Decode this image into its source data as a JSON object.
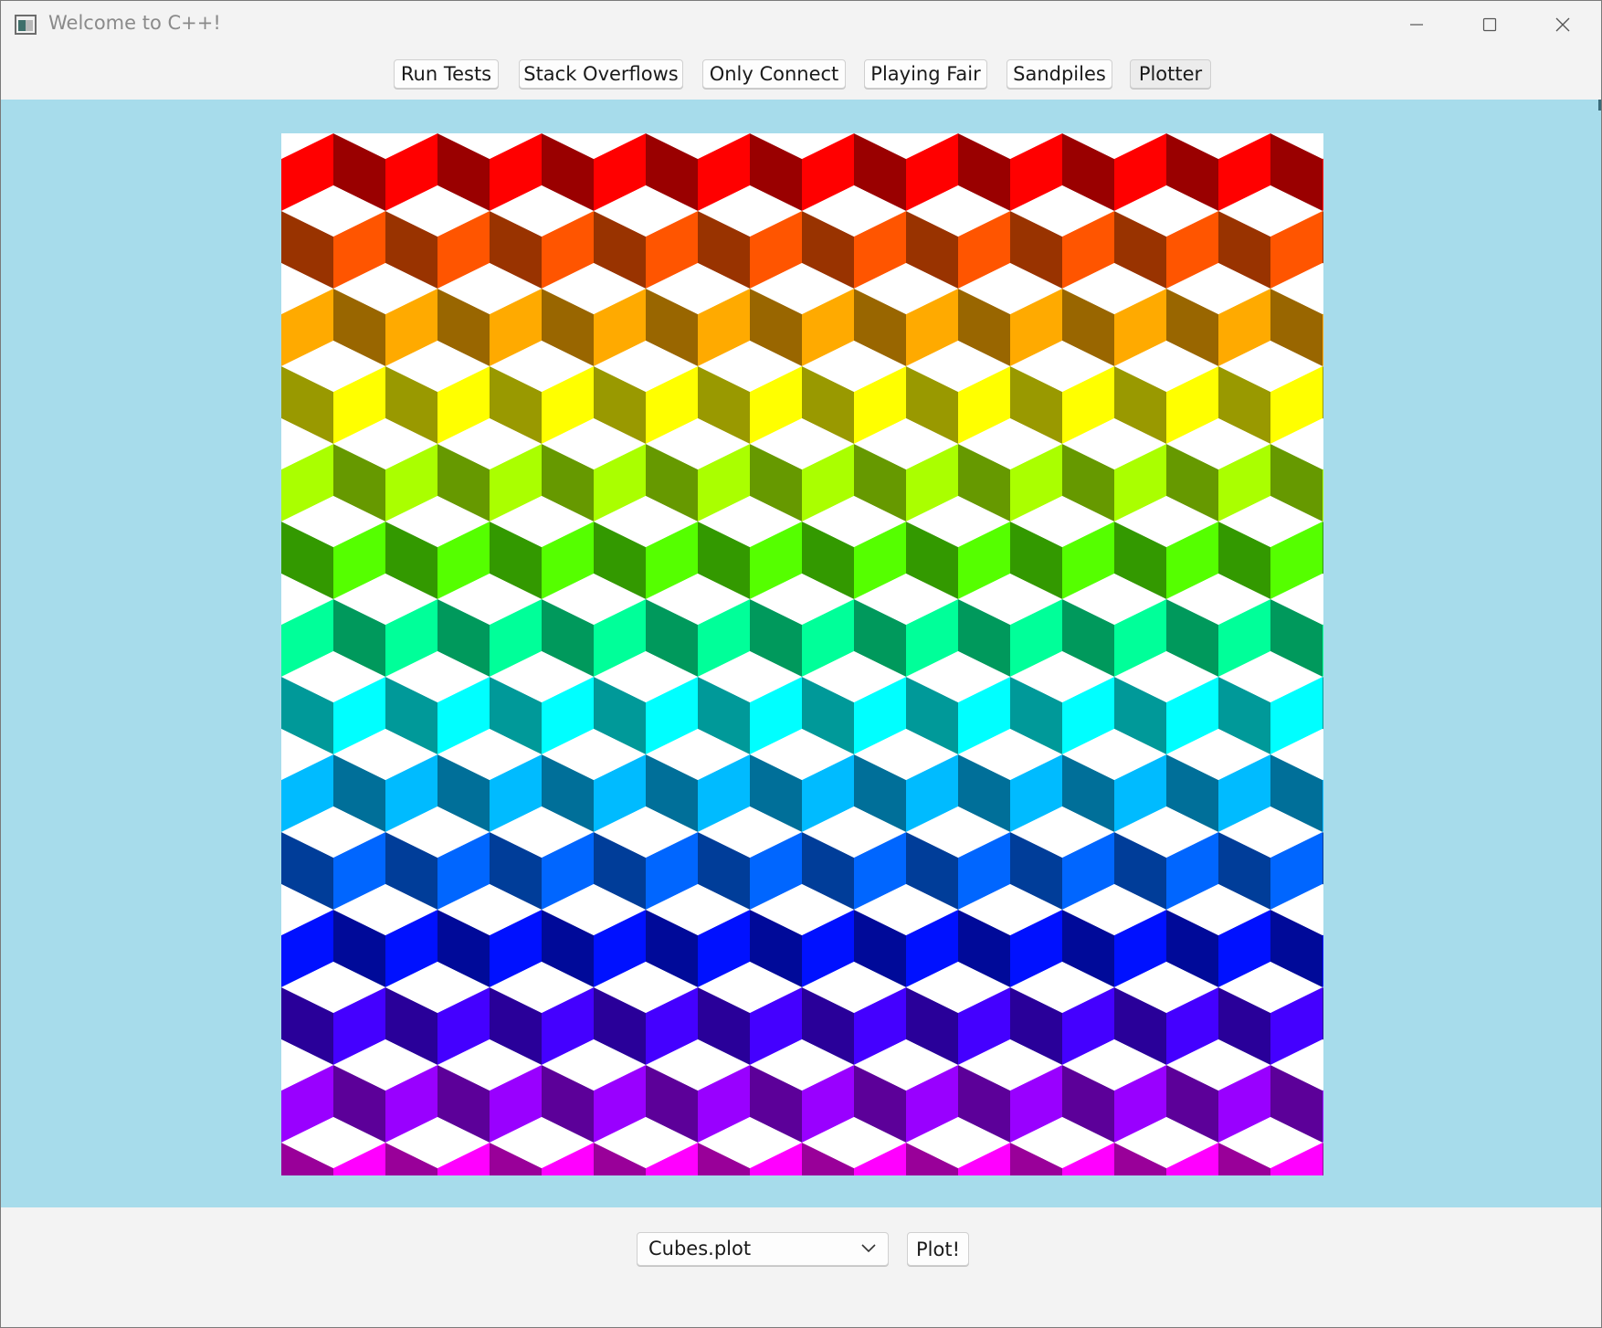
{
  "window": {
    "title": "Welcome to C++!",
    "controls": [
      "minimize-icon",
      "maximize-icon",
      "close-icon"
    ]
  },
  "toolbar": {
    "buttons": [
      {
        "label": "Run Tests"
      },
      {
        "label": "Stack Overflows"
      },
      {
        "label": "Only Connect"
      },
      {
        "label": "Playing Fair"
      },
      {
        "label": "Sandpiles"
      },
      {
        "label": "Plotter"
      }
    ],
    "selected": "Plotter"
  },
  "plotter": {
    "background_color": "#a7dceb",
    "canvas_background": "#ffffff",
    "pattern": "isometric cubes",
    "row_colors": [
      {
        "light": "#ff0000",
        "dark": "#9a0000"
      },
      {
        "light": "#ff5500",
        "dark": "#993300"
      },
      {
        "light": "#ffaa00",
        "dark": "#996600"
      },
      {
        "light": "#ffff00",
        "dark": "#999900"
      },
      {
        "light": "#aaff00",
        "dark": "#669900"
      },
      {
        "light": "#55ff00",
        "dark": "#339900"
      },
      {
        "light": "#00ff99",
        "dark": "#00995c"
      },
      {
        "light": "#00ffff",
        "dark": "#009999"
      },
      {
        "light": "#00bbff",
        "dark": "#006f99"
      },
      {
        "light": "#0066ff",
        "dark": "#003d99"
      },
      {
        "light": "#0011ff",
        "dark": "#000a99"
      },
      {
        "light": "#4400ff",
        "dark": "#290099"
      },
      {
        "light": "#9900ff",
        "dark": "#5c0099"
      },
      {
        "light": "#ff00ff",
        "dark": "#990099"
      }
    ]
  },
  "bottom": {
    "file_select": {
      "value": "Cubes.plot"
    },
    "plot_button_label": "Plot!"
  }
}
